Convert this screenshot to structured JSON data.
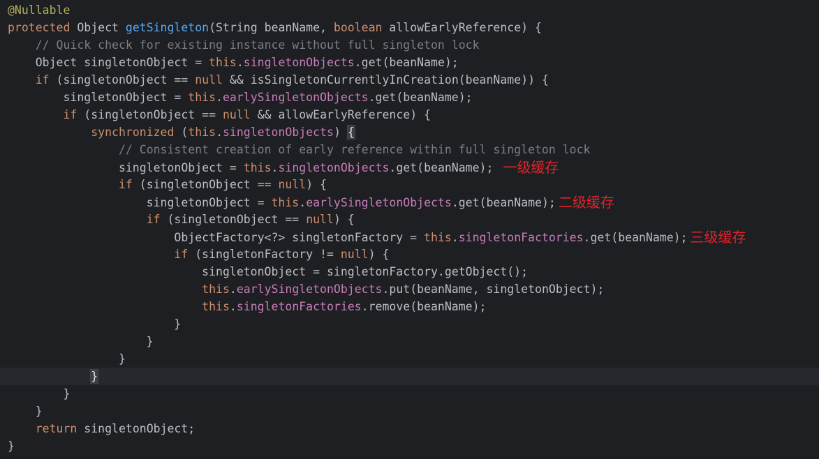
{
  "colors": {
    "background": "#1e1f22",
    "text": "#bcbec4",
    "keyword": "#cf8e6d",
    "annotation": "#b3ae60",
    "method": "#56a8f5",
    "field": "#c77dbb",
    "comment": "#7a7e85",
    "note": "#e0242b",
    "current_line": "#26282e"
  },
  "lines": [
    [
      {
        "t": "@Nullable",
        "c": "ann"
      }
    ],
    [
      {
        "t": "protected",
        "c": "kw"
      },
      {
        "t": " Object "
      },
      {
        "t": "getSingleton",
        "c": "fn"
      },
      {
        "t": "(String beanName, "
      },
      {
        "t": "boolean",
        "c": "kw"
      },
      {
        "t": " allowEarlyReference) {"
      }
    ],
    [
      {
        "t": "    "
      },
      {
        "t": "// Quick check for existing instance without full singleton lock",
        "c": "cmt"
      }
    ],
    [
      {
        "t": "    Object singletonObject = "
      },
      {
        "t": "this",
        "c": "kw"
      },
      {
        "t": "."
      },
      {
        "t": "singletonObjects",
        "c": "fld"
      },
      {
        "t": ".get(beanName);"
      }
    ],
    [
      {
        "t": "    "
      },
      {
        "t": "if",
        "c": "kw"
      },
      {
        "t": " (singletonObject == "
      },
      {
        "t": "null",
        "c": "kw"
      },
      {
        "t": " && isSingletonCurrentlyInCreation(beanName)) {"
      }
    ],
    [
      {
        "t": "        singletonObject = "
      },
      {
        "t": "this",
        "c": "kw"
      },
      {
        "t": "."
      },
      {
        "t": "earlySingletonObjects",
        "c": "fld"
      },
      {
        "t": ".get(beanName);"
      }
    ],
    [
      {
        "t": "        "
      },
      {
        "t": "if",
        "c": "kw"
      },
      {
        "t": " (singletonObject == "
      },
      {
        "t": "null",
        "c": "kw"
      },
      {
        "t": " && allowEarlyReference) {"
      }
    ],
    [
      {
        "t": "            "
      },
      {
        "t": "synchronized",
        "c": "kw"
      },
      {
        "t": " ("
      },
      {
        "t": "this",
        "c": "kw"
      },
      {
        "t": "."
      },
      {
        "t": "singletonObjects",
        "c": "fld"
      },
      {
        "t": ") "
      },
      {
        "t": "{",
        "c": "brace-hl"
      }
    ],
    [
      {
        "t": "                "
      },
      {
        "t": "// Consistent creation of early reference within full singleton lock",
        "c": "cmt"
      }
    ],
    [
      {
        "t": "                singletonObject = "
      },
      {
        "t": "this",
        "c": "kw"
      },
      {
        "t": "."
      },
      {
        "t": "singletonObjects",
        "c": "fld"
      },
      {
        "t": ".get(beanName); "
      },
      {
        "t": "一级缓存",
        "c": "note"
      }
    ],
    [
      {
        "t": "                "
      },
      {
        "t": "if",
        "c": "kw"
      },
      {
        "t": " (singletonObject == "
      },
      {
        "t": "null",
        "c": "kw"
      },
      {
        "t": ") {"
      }
    ],
    [
      {
        "t": "                    singletonObject = "
      },
      {
        "t": "this",
        "c": "kw"
      },
      {
        "t": "."
      },
      {
        "t": "earlySingletonObjects",
        "c": "fld"
      },
      {
        "t": ".get(beanName);"
      },
      {
        "t": "二级缓存",
        "c": "note"
      }
    ],
    [
      {
        "t": "                    "
      },
      {
        "t": "if",
        "c": "kw"
      },
      {
        "t": " (singletonObject == "
      },
      {
        "t": "null",
        "c": "kw"
      },
      {
        "t": ") {"
      }
    ],
    [
      {
        "t": "                        ObjectFactory<?> singletonFactory = "
      },
      {
        "t": "this",
        "c": "kw"
      },
      {
        "t": "."
      },
      {
        "t": "singletonFactories",
        "c": "fld"
      },
      {
        "t": ".get(beanName);"
      },
      {
        "t": "三级缓存",
        "c": "note"
      }
    ],
    [
      {
        "t": "                        "
      },
      {
        "t": "if",
        "c": "kw"
      },
      {
        "t": " (singletonFactory != "
      },
      {
        "t": "null",
        "c": "kw"
      },
      {
        "t": ") {"
      }
    ],
    [
      {
        "t": "                            singletonObject = singletonFactory.getObject();"
      }
    ],
    [
      {
        "t": "                            "
      },
      {
        "t": "this",
        "c": "kw"
      },
      {
        "t": "."
      },
      {
        "t": "earlySingletonObjects",
        "c": "fld"
      },
      {
        "t": ".put(beanName, singletonObject);"
      }
    ],
    [
      {
        "t": "                            "
      },
      {
        "t": "this",
        "c": "kw"
      },
      {
        "t": "."
      },
      {
        "t": "singletonFactories",
        "c": "fld"
      },
      {
        "t": ".remove(beanName);"
      }
    ],
    [
      {
        "t": "                        }"
      }
    ],
    [
      {
        "t": "                    }"
      }
    ],
    [
      {
        "t": "                }"
      }
    ],
    [
      {
        "t": "            "
      },
      {
        "t": "}",
        "c": "brace-hl"
      }
    ],
    [
      {
        "t": "        }"
      }
    ],
    [
      {
        "t": "    }"
      }
    ],
    [
      {
        "t": "    "
      },
      {
        "t": "return",
        "c": "kw"
      },
      {
        "t": " singletonObject;"
      }
    ],
    [
      {
        "t": "}"
      }
    ]
  ],
  "current_line": 22
}
